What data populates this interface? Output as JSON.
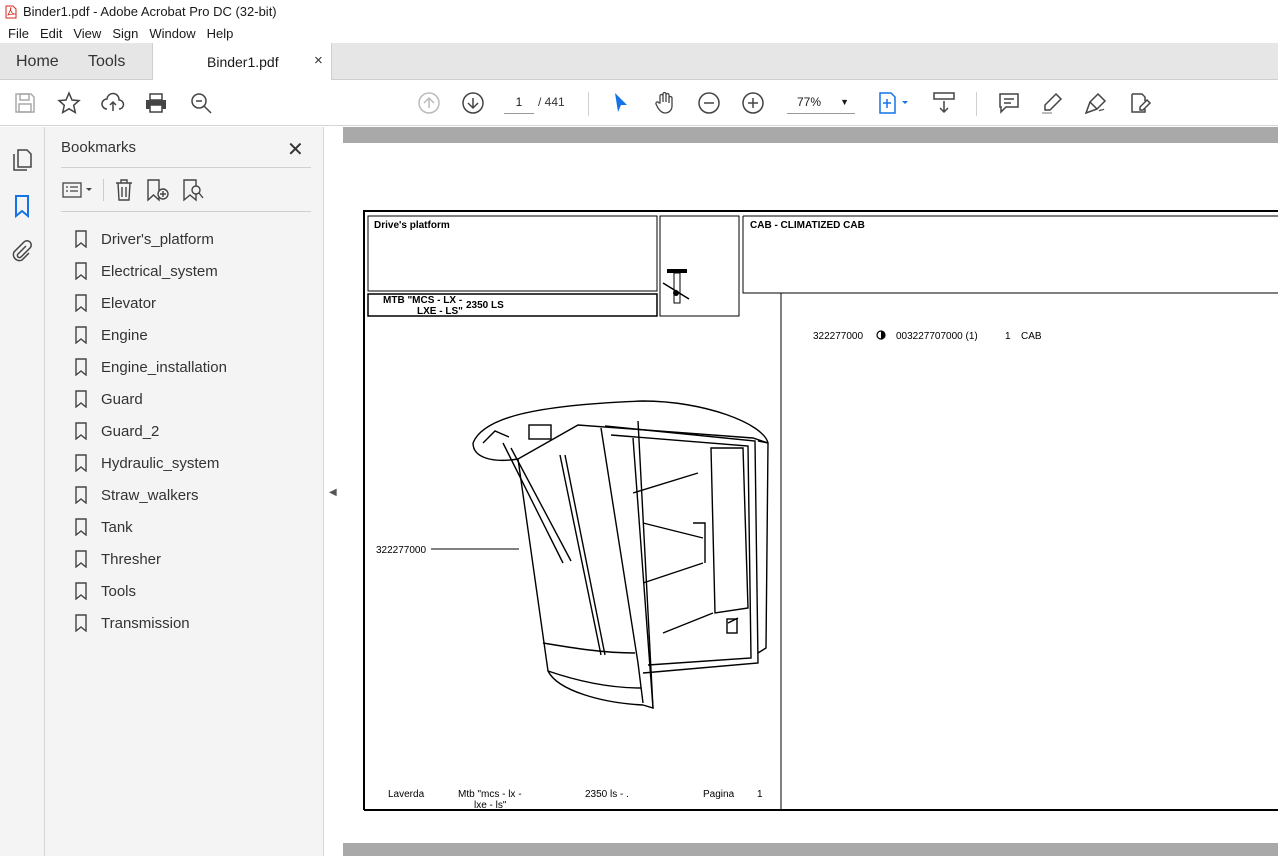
{
  "window": {
    "title": "Binder1.pdf - Adobe Acrobat Pro DC (32-bit)"
  },
  "menu": [
    "File",
    "Edit",
    "View",
    "Sign",
    "Window",
    "Help"
  ],
  "tabs": {
    "home": "Home",
    "tools": "Tools",
    "document": "Binder1.pdf",
    "close": "×"
  },
  "toolbar": {
    "page_current": "1",
    "page_total": "/ 441",
    "zoom": "77%"
  },
  "bookmarks": {
    "title": "Bookmarks",
    "items": [
      "Driver's_platform",
      "Electrical_system",
      "Elevator",
      "Engine",
      "Engine_installation",
      "Guard",
      "Guard_2",
      "Hydraulic_system",
      "Straw_walkers",
      "Tank",
      "Thresher",
      "Tools",
      "Transmission"
    ]
  },
  "document": {
    "header_left": "Drive's platform",
    "model_line1": "MTB \"MCS - LX -",
    "model_line2": "LXE - LS\"",
    "model_code": "2350  LS",
    "header_right": "CAB - CLIMATIZED CAB",
    "part_ref": "322277000",
    "parts_row": {
      "ref": "322277000",
      "code": "003227707000  (1)",
      "qty": "1",
      "desc": "CAB"
    },
    "footer": {
      "brand": "Laverda",
      "model1": "Mtb \"mcs - lx -",
      "model2": "lxe - ls\"",
      "code": "2350  ls - .",
      "page_label": "Pagina",
      "page_num": "1"
    }
  }
}
